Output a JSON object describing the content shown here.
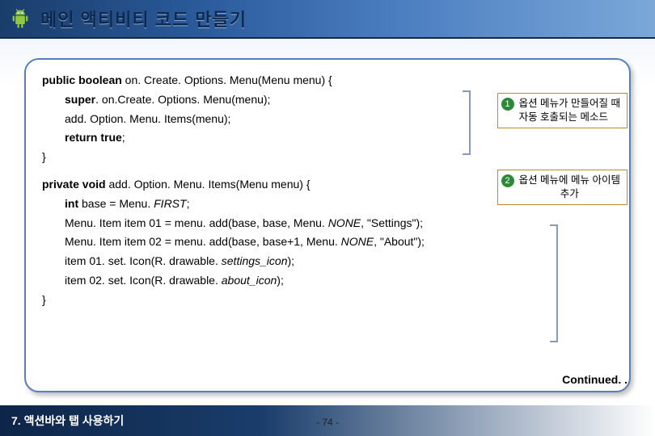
{
  "header": {
    "title": "메인 액티비티 코드 만들기"
  },
  "code": {
    "l1_a": "public boolean",
    "l1_b": " on. Create. Options. Menu(Menu  menu) {",
    "l2_a": "super",
    "l2_b": ". on.Create. Options. Menu(menu);",
    "l3": "add. Option. Menu. Items(menu);",
    "l4_a": "return true",
    "l4_b": ";",
    "l5": "}",
    "l6_a": "private void",
    "l6_b": " add. Option. Menu. Items(Menu  menu) {",
    "l7_a": "int",
    "l7_b": " base = Menu. ",
    "l7_c": "FIRST",
    "l7_d": ";",
    "l8_a": "Menu. Item  item 01 = menu. add(base,  base,  Menu. ",
    "l8_b": "NONE",
    "l8_c": ", \"Settings\");",
    "l9_a": "Menu. Item  item 02 = menu. add(base,  base+1,  Menu. ",
    "l9_b": "NONE",
    "l9_c": ", \"About\");",
    "l10_a": "item 01. set. Icon(R. drawable. ",
    "l10_b": "settings_icon",
    "l10_c": ");",
    "l11_a": "item 02. set. Icon(R. drawable. ",
    "l11_b": "about_icon",
    "l11_c": ");",
    "l12": "}"
  },
  "callouts": {
    "c1_num": "1",
    "c1_l1": "옵션 메뉴가 만들어질 때",
    "c1_l2": "자동 호출되는 메소드",
    "c2_num": "2",
    "c2_l1": "옵션 메뉴에 메뉴 아이템",
    "c2_l2": "추가"
  },
  "continued": "Continued. .",
  "footer": {
    "chapter": "7. 액션바와 탭 사용하기",
    "page": "- 74 -"
  }
}
